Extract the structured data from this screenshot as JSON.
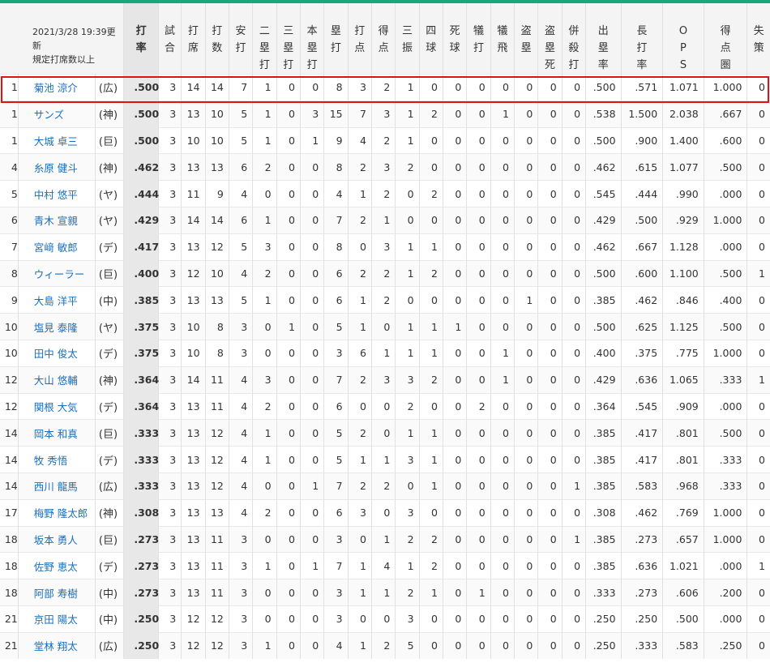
{
  "header": {
    "updated": "2021/3/28 19:39更新",
    "qualifier": "規定打席数以上",
    "columns": [
      "打率",
      "試合",
      "打席",
      "打数",
      "安打",
      "二塁打",
      "三塁打",
      "本塁打",
      "塁打",
      "打点",
      "得点",
      "三振",
      "四球",
      "死球",
      "犠打",
      "犠飛",
      "盗塁",
      "盗塁死",
      "併殺打",
      "出塁率",
      "長打率",
      "OPS",
      "得点圏",
      "失策"
    ]
  },
  "highlight_color": "#e31212",
  "accent_color": "#1aa57a",
  "rows": [
    {
      "rank": "1",
      "name": "菊池 涼介",
      "team": "(広)",
      "stats": [
        ".500",
        "3",
        "14",
        "14",
        "7",
        "1",
        "0",
        "0",
        "8",
        "3",
        "2",
        "1",
        "0",
        "0",
        "0",
        "0",
        "0",
        "0",
        "0",
        ".500",
        ".571",
        "1.071",
        "1.000",
        "0"
      ]
    },
    {
      "rank": "1",
      "name": "サンズ",
      "team": "(神)",
      "stats": [
        ".500",
        "3",
        "13",
        "10",
        "5",
        "1",
        "0",
        "3",
        "15",
        "7",
        "3",
        "1",
        "2",
        "0",
        "0",
        "1",
        "0",
        "0",
        "0",
        ".538",
        "1.500",
        "2.038",
        ".667",
        "0"
      ]
    },
    {
      "rank": "1",
      "name": "大城 卓三",
      "team": "(巨)",
      "stats": [
        ".500",
        "3",
        "10",
        "10",
        "5",
        "1",
        "0",
        "1",
        "9",
        "4",
        "2",
        "1",
        "0",
        "0",
        "0",
        "0",
        "0",
        "0",
        "0",
        ".500",
        ".900",
        "1.400",
        ".600",
        "0"
      ]
    },
    {
      "rank": "4",
      "name": "糸原 健斗",
      "team": "(神)",
      "stats": [
        ".462",
        "3",
        "13",
        "13",
        "6",
        "2",
        "0",
        "0",
        "8",
        "2",
        "3",
        "2",
        "0",
        "0",
        "0",
        "0",
        "0",
        "0",
        "0",
        ".462",
        ".615",
        "1.077",
        ".500",
        "0"
      ]
    },
    {
      "rank": "5",
      "name": "中村 悠平",
      "team": "(ヤ)",
      "stats": [
        ".444",
        "3",
        "11",
        "9",
        "4",
        "0",
        "0",
        "0",
        "4",
        "1",
        "2",
        "0",
        "2",
        "0",
        "0",
        "0",
        "0",
        "0",
        "0",
        ".545",
        ".444",
        ".990",
        ".000",
        "0"
      ]
    },
    {
      "rank": "6",
      "name": "青木 宣親",
      "team": "(ヤ)",
      "stats": [
        ".429",
        "3",
        "14",
        "14",
        "6",
        "1",
        "0",
        "0",
        "7",
        "2",
        "1",
        "0",
        "0",
        "0",
        "0",
        "0",
        "0",
        "0",
        "0",
        ".429",
        ".500",
        ".929",
        "1.000",
        "0"
      ]
    },
    {
      "rank": "7",
      "name": "宮﨑 敏郎",
      "team": "(デ)",
      "stats": [
        ".417",
        "3",
        "13",
        "12",
        "5",
        "3",
        "0",
        "0",
        "8",
        "0",
        "3",
        "1",
        "1",
        "0",
        "0",
        "0",
        "0",
        "0",
        "0",
        ".462",
        ".667",
        "1.128",
        ".000",
        "0"
      ]
    },
    {
      "rank": "8",
      "name": "ウィーラー",
      "team": "(巨)",
      "stats": [
        ".400",
        "3",
        "12",
        "10",
        "4",
        "2",
        "0",
        "0",
        "6",
        "2",
        "2",
        "1",
        "2",
        "0",
        "0",
        "0",
        "0",
        "0",
        "0",
        ".500",
        ".600",
        "1.100",
        ".500",
        "1"
      ]
    },
    {
      "rank": "9",
      "name": "大島 洋平",
      "team": "(中)",
      "stats": [
        ".385",
        "3",
        "13",
        "13",
        "5",
        "1",
        "0",
        "0",
        "6",
        "1",
        "2",
        "0",
        "0",
        "0",
        "0",
        "0",
        "1",
        "0",
        "0",
        ".385",
        ".462",
        ".846",
        ".400",
        "0"
      ]
    },
    {
      "rank": "10",
      "name": "塩見 泰隆",
      "team": "(ヤ)",
      "stats": [
        ".375",
        "3",
        "10",
        "8",
        "3",
        "0",
        "1",
        "0",
        "5",
        "1",
        "0",
        "1",
        "1",
        "1",
        "0",
        "0",
        "0",
        "0",
        "0",
        ".500",
        ".625",
        "1.125",
        ".500",
        "0"
      ]
    },
    {
      "rank": "10",
      "name": "田中 俊太",
      "team": "(デ)",
      "stats": [
        ".375",
        "3",
        "10",
        "8",
        "3",
        "0",
        "0",
        "0",
        "3",
        "6",
        "1",
        "1",
        "1",
        "0",
        "0",
        "1",
        "0",
        "0",
        "0",
        ".400",
        ".375",
        ".775",
        "1.000",
        "0"
      ]
    },
    {
      "rank": "12",
      "name": "大山 悠輔",
      "team": "(神)",
      "stats": [
        ".364",
        "3",
        "14",
        "11",
        "4",
        "3",
        "0",
        "0",
        "7",
        "2",
        "3",
        "3",
        "2",
        "0",
        "0",
        "1",
        "0",
        "0",
        "0",
        ".429",
        ".636",
        "1.065",
        ".333",
        "1"
      ]
    },
    {
      "rank": "12",
      "name": "関根 大気",
      "team": "(デ)",
      "stats": [
        ".364",
        "3",
        "13",
        "11",
        "4",
        "2",
        "0",
        "0",
        "6",
        "0",
        "0",
        "2",
        "0",
        "0",
        "2",
        "0",
        "0",
        "0",
        "0",
        ".364",
        ".545",
        ".909",
        ".000",
        "0"
      ]
    },
    {
      "rank": "14",
      "name": "岡本 和真",
      "team": "(巨)",
      "stats": [
        ".333",
        "3",
        "13",
        "12",
        "4",
        "1",
        "0",
        "0",
        "5",
        "2",
        "0",
        "1",
        "1",
        "0",
        "0",
        "0",
        "0",
        "0",
        "0",
        ".385",
        ".417",
        ".801",
        ".500",
        "0"
      ]
    },
    {
      "rank": "14",
      "name": "牧 秀悟",
      "team": "(デ)",
      "stats": [
        ".333",
        "3",
        "13",
        "12",
        "4",
        "1",
        "0",
        "0",
        "5",
        "1",
        "1",
        "3",
        "1",
        "0",
        "0",
        "0",
        "0",
        "0",
        "0",
        ".385",
        ".417",
        ".801",
        ".333",
        "0"
      ]
    },
    {
      "rank": "14",
      "name": "西川 龍馬",
      "team": "(広)",
      "stats": [
        ".333",
        "3",
        "13",
        "12",
        "4",
        "0",
        "0",
        "1",
        "7",
        "2",
        "2",
        "0",
        "1",
        "0",
        "0",
        "0",
        "0",
        "0",
        "1",
        ".385",
        ".583",
        ".968",
        ".333",
        "0"
      ]
    },
    {
      "rank": "17",
      "name": "梅野 隆太郎",
      "team": "(神)",
      "stats": [
        ".308",
        "3",
        "13",
        "13",
        "4",
        "2",
        "0",
        "0",
        "6",
        "3",
        "0",
        "3",
        "0",
        "0",
        "0",
        "0",
        "0",
        "0",
        "0",
        ".308",
        ".462",
        ".769",
        "1.000",
        "0"
      ]
    },
    {
      "rank": "18",
      "name": "坂本 勇人",
      "team": "(巨)",
      "stats": [
        ".273",
        "3",
        "13",
        "11",
        "3",
        "0",
        "0",
        "0",
        "3",
        "0",
        "1",
        "2",
        "2",
        "0",
        "0",
        "0",
        "0",
        "0",
        "1",
        ".385",
        ".273",
        ".657",
        "1.000",
        "0"
      ]
    },
    {
      "rank": "18",
      "name": "佐野 恵太",
      "team": "(デ)",
      "stats": [
        ".273",
        "3",
        "13",
        "11",
        "3",
        "1",
        "0",
        "1",
        "7",
        "1",
        "4",
        "1",
        "2",
        "0",
        "0",
        "0",
        "0",
        "0",
        "0",
        ".385",
        ".636",
        "1.021",
        ".000",
        "1"
      ]
    },
    {
      "rank": "18",
      "name": "阿部 寿樹",
      "team": "(中)",
      "stats": [
        ".273",
        "3",
        "13",
        "11",
        "3",
        "0",
        "0",
        "0",
        "3",
        "1",
        "1",
        "2",
        "1",
        "0",
        "1",
        "0",
        "0",
        "0",
        "0",
        ".333",
        ".273",
        ".606",
        ".200",
        "0"
      ]
    },
    {
      "rank": "21",
      "name": "京田 陽太",
      "team": "(中)",
      "stats": [
        ".250",
        "3",
        "12",
        "12",
        "3",
        "0",
        "0",
        "0",
        "3",
        "0",
        "0",
        "3",
        "0",
        "0",
        "0",
        "0",
        "0",
        "0",
        "0",
        ".250",
        ".250",
        ".500",
        ".000",
        "0"
      ]
    },
    {
      "rank": "21",
      "name": "堂林 翔太",
      "team": "(広)",
      "stats": [
        ".250",
        "3",
        "12",
        "12",
        "3",
        "1",
        "0",
        "0",
        "4",
        "1",
        "2",
        "5",
        "0",
        "0",
        "0",
        "0",
        "0",
        "0",
        "0",
        ".250",
        ".333",
        ".583",
        ".250",
        "0"
      ]
    }
  ]
}
